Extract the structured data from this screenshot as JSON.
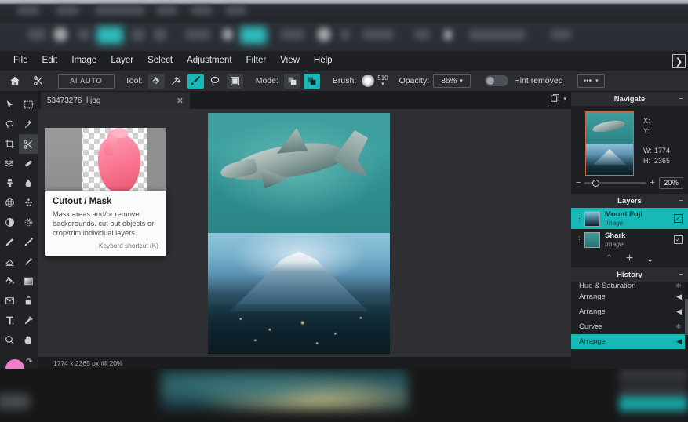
{
  "menu": {
    "items": [
      "File",
      "Edit",
      "Image",
      "Layer",
      "Select",
      "Adjustment",
      "Filter",
      "View",
      "Help"
    ],
    "collapse_icon": "chevron-right-icon"
  },
  "options_bar": {
    "home_icon": "home-icon",
    "cut_icon": "scissors-icon",
    "ai_auto_label": "AI AUTO",
    "tool_label": "Tool:",
    "tool_icons": [
      "paint-bucket-icon",
      "magic-wand-icon",
      "brush-icon",
      "lasso-icon",
      "square-mask-icon"
    ],
    "tool_active_index": 2,
    "mode_label": "Mode:",
    "mode_icons": [
      "subtract-shapes-icon",
      "add-shapes-icon"
    ],
    "mode_active_index": 1,
    "brush_label": "Brush:",
    "brush_size": "510",
    "opacity_label": "Opacity:",
    "opacity_value": "86%",
    "hint_label": "Hint removed",
    "hint_enabled": false,
    "more_label": "•••"
  },
  "toolbar": {
    "tools": [
      {
        "name": "move-tool",
        "glyph": "pointer"
      },
      {
        "name": "marquee-select-tool",
        "glyph": "marquee"
      },
      {
        "name": "lasso-tool",
        "glyph": "lasso"
      },
      {
        "name": "magic-wand-tool",
        "glyph": "wand"
      },
      {
        "name": "crop-tool",
        "glyph": "crop"
      },
      {
        "name": "cutout-mask-tool",
        "glyph": "scissors"
      },
      {
        "name": "liquify-tool",
        "glyph": "waves"
      },
      {
        "name": "heal-tool",
        "glyph": "bandage"
      },
      {
        "name": "clone-stamp-tool",
        "glyph": "stamp"
      },
      {
        "name": "blur-tool",
        "glyph": "drop"
      },
      {
        "name": "mesh-warp-tool",
        "glyph": "globe"
      },
      {
        "name": "scatter-tool",
        "glyph": "particles"
      },
      {
        "name": "contrast-tool",
        "glyph": "halfcircle"
      },
      {
        "name": "settings-tool",
        "glyph": "gear"
      },
      {
        "name": "pencil-tool",
        "glyph": "pencil"
      },
      {
        "name": "paintbrush-tool",
        "glyph": "paintbrush"
      },
      {
        "name": "eraser-tool",
        "glyph": "eraser"
      },
      {
        "name": "smudge-tool",
        "glyph": "smudge"
      },
      {
        "name": "paint-bucket-tool",
        "glyph": "bucket"
      },
      {
        "name": "gradient-tool",
        "glyph": "gradient"
      },
      {
        "name": "envelope-tool",
        "glyph": "envelope"
      },
      {
        "name": "lock-tool",
        "glyph": "lock"
      },
      {
        "name": "text-tool",
        "glyph": "text"
      },
      {
        "name": "eyedropper-tool",
        "glyph": "eyedropper"
      },
      {
        "name": "zoom-tool",
        "glyph": "magnifier"
      },
      {
        "name": "hand-tool",
        "glyph": "hand"
      }
    ],
    "active_tool_index": 5,
    "foreground_color": "#f07fc8",
    "background_color": "#fa7268",
    "swap_icon": "swap-colors-icon"
  },
  "tab": {
    "title": "53473276_l.jpg",
    "close_icon": "close-icon",
    "window_icon": "duplicate-window-icon",
    "window_caret": "▾"
  },
  "status": {
    "text": "1774 x 2365 px @ 20%"
  },
  "tooltip": {
    "title": "Cutout / Mask",
    "body": "Mask areas and/or remove backgrounds. cut out objects or crop/trim individual layers.",
    "shortcut": "Keybord shortcut (K)"
  },
  "navigate": {
    "title": "Navigate",
    "minimize_icon": "minimize-icon",
    "fields": [
      {
        "key": "X:",
        "value": ""
      },
      {
        "key": "Y:",
        "value": ""
      },
      {
        "key": "W:",
        "value": "1774"
      },
      {
        "key": "H:",
        "value": "2365"
      }
    ],
    "zoom_out_icon": "minus-icon",
    "zoom_in_icon": "plus-icon",
    "zoom_value": "20%"
  },
  "layers": {
    "title": "Layers",
    "minimize_icon": "minimize-icon",
    "items": [
      {
        "name": "Mount Fuji",
        "kind": "Image",
        "selected": true,
        "visible": true
      },
      {
        "name": "Shark",
        "kind": "Image",
        "selected": false,
        "visible": true
      }
    ],
    "footer": {
      "up_icon": "chevron-up-icon",
      "add_icon": "plus-icon",
      "down_icon": "chevron-down-icon"
    }
  },
  "history": {
    "title": "History",
    "minimize_icon": "minimize-icon",
    "items": [
      {
        "label": "Hue & Saturation",
        "icon": "hue-saturation-icon",
        "selected": false,
        "clipped": true
      },
      {
        "label": "Arrange",
        "icon": "arrange-icon",
        "selected": false,
        "clipped": false
      },
      {
        "label": "Arrange",
        "icon": "arrange-icon",
        "selected": false,
        "clipped": false
      },
      {
        "label": "Curves",
        "icon": "curves-icon",
        "selected": false,
        "clipped": false
      },
      {
        "label": "Arrange",
        "icon": "arrange-icon",
        "selected": true,
        "clipped": false
      }
    ]
  },
  "colors": {
    "accent": "#17b8b8",
    "panel_bg": "#1e1f22",
    "canvas_bg": "#2e3034"
  }
}
